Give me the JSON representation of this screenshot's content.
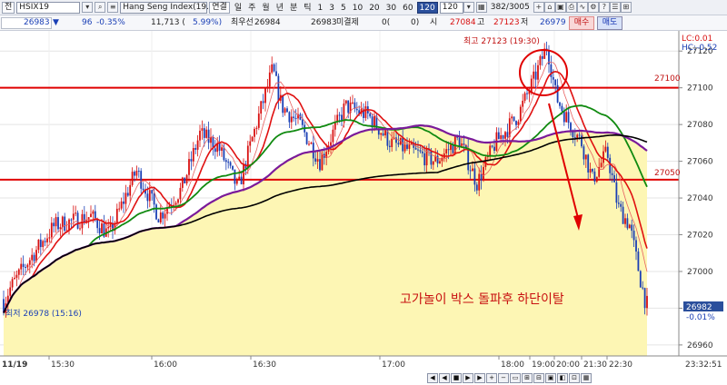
{
  "toolbar": {
    "jeon_label": "전",
    "symbol": "HSIX19",
    "index_name": "Hang Seng Index(19.1",
    "chain_label": "연결",
    "periods": [
      "일",
      "주",
      "월",
      "년",
      "분",
      "틱",
      "1",
      "3",
      "5",
      "10",
      "20",
      "30",
      "60",
      "120"
    ],
    "active_period": "120",
    "period_value": "120",
    "counter": "382/3005"
  },
  "quote": {
    "price": "26983",
    "change_arrow": "▼",
    "change": "96",
    "change_pct": "-0.35%",
    "volume": "11,713 (",
    "volume_pct": "5.99%)",
    "best_ask_label": "최우선",
    "best_ask": "26984",
    "best_bid": "26983",
    "unfilled_label": "미결제",
    "unfilled": "0(",
    "unfilled_chg": "0)",
    "open_label": "시",
    "open": "27084",
    "high_label": "고",
    "high": "27123",
    "low_label": "저",
    "low": "26979",
    "buy_label": "매수",
    "sell_label": "매도"
  },
  "chart_labels": {
    "high_marker": "최고 27123 (19:30)",
    "low_marker": "최저 26978 (15:16)",
    "lc": "LC:0.01",
    "hc": "HC:-0.52",
    "line_upper": "27100",
    "line_lower": "27050",
    "current_price": "26982",
    "current_pct": "-0.01%",
    "annotation": "고가놀이 박스 돌파후 하단이탈",
    "date": "11/19",
    "clock": "23:32:51"
  },
  "colors": {
    "up": "#d81010",
    "down": "#1a3fb5",
    "fill": "#fdf6b4",
    "ma_red": "#e01010",
    "ma_green": "#108a10",
    "ma_purple": "#7a1a9a",
    "ma_black": "#000000",
    "box_line": "#e00000"
  },
  "chart_data": {
    "type": "candlestick",
    "y_ticks": [
      27120,
      27100,
      27080,
      27060,
      27040,
      27020,
      27000,
      26980,
      26960
    ],
    "x_ticks": [
      "15:30",
      "16:00",
      "16:30",
      "17:00",
      "18:00",
      "19:00",
      "20:00",
      "21:30",
      "22:30"
    ],
    "horizontal_lines": [
      27100,
      27050
    ],
    "ylim": [
      26955,
      27130
    ],
    "day_high": 27123,
    "day_low": 26978,
    "last": 26982
  },
  "scrollbar": {
    "buttons": [
      "◀",
      "◀",
      "■",
      "▶",
      "▶",
      "+",
      "−",
      "▭",
      "⊞",
      "⊟",
      "▣",
      "◧",
      "⊡",
      "▦"
    ]
  }
}
